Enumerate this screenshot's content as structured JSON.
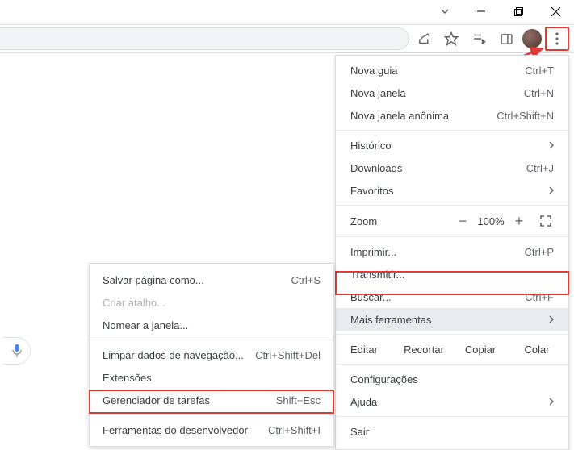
{
  "menu": {
    "new_tab": {
      "label": "Nova guia",
      "shortcut": "Ctrl+T"
    },
    "new_window": {
      "label": "Nova janela",
      "shortcut": "Ctrl+N"
    },
    "incognito": {
      "label": "Nova janela anônima",
      "shortcut": "Ctrl+Shift+N"
    },
    "history": {
      "label": "Histórico"
    },
    "downloads": {
      "label": "Downloads",
      "shortcut": "Ctrl+J"
    },
    "bookmarks": {
      "label": "Favoritos"
    },
    "zoom": {
      "label": "Zoom",
      "value": "100%",
      "minus": "−",
      "plus": "+"
    },
    "print": {
      "label": "Imprimir...",
      "shortcut": "Ctrl+P"
    },
    "cast": {
      "label": "Transmitir..."
    },
    "find": {
      "label": "Buscar...",
      "shortcut": "Ctrl+F"
    },
    "more_tools": {
      "label": "Mais ferramentas"
    },
    "edit": {
      "label": "Editar",
      "cut": "Recortar",
      "copy": "Copiar",
      "paste": "Colar"
    },
    "settings": {
      "label": "Configurações"
    },
    "help": {
      "label": "Ajuda"
    },
    "exit": {
      "label": "Sair"
    }
  },
  "submenu": {
    "save_page": {
      "label": "Salvar página como...",
      "shortcut": "Ctrl+S"
    },
    "create_shortcut": {
      "label": "Criar atalho..."
    },
    "name_window": {
      "label": "Nomear a janela..."
    },
    "clear_data": {
      "label": "Limpar dados de navegação...",
      "shortcut": "Ctrl+Shift+Del"
    },
    "extensions": {
      "label": "Extensões"
    },
    "task_manager": {
      "label": "Gerenciador de tarefas",
      "shortcut": "Shift+Esc"
    },
    "dev_tools": {
      "label": "Ferramentas do desenvolvedor",
      "shortcut": "Ctrl+Shift+I"
    }
  }
}
